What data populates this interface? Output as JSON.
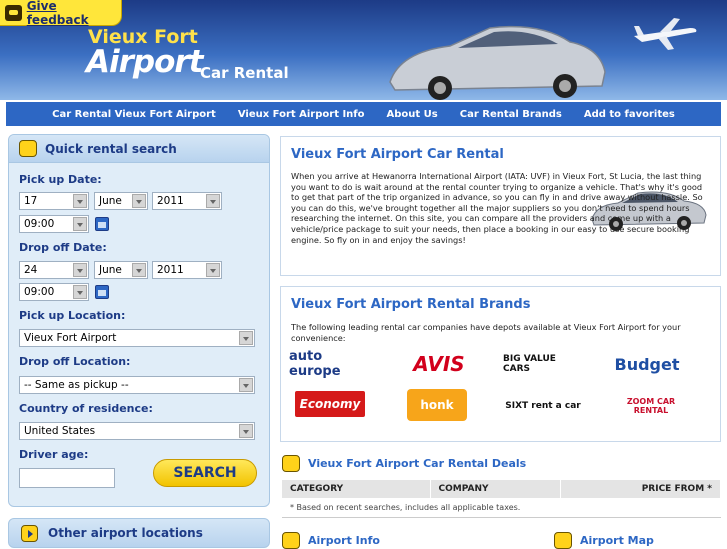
{
  "header": {
    "feedback_label": "Give feedback",
    "logo_line1": "Vieux Fort",
    "logo_line2": "Airport",
    "logo_line3": "Car Rental"
  },
  "nav": [
    "Car Rental Vieux Fort Airport",
    "Vieux Fort Airport Info",
    "About Us",
    "Car Rental Brands",
    "Add to favorites"
  ],
  "search": {
    "title": "Quick rental search",
    "pickup_date_label": "Pick up Date:",
    "pickup_day": "17",
    "pickup_month": "June",
    "pickup_year": "2011",
    "pickup_time": "09:00",
    "dropoff_date_label": "Drop off Date:",
    "dropoff_day": "24",
    "dropoff_month": "June",
    "dropoff_year": "2011",
    "dropoff_time": "09:00",
    "pickup_location_label": "Pick up Location:",
    "pickup_location": "Vieux Fort Airport",
    "dropoff_location_label": "Drop off Location:",
    "dropoff_location": "-- Same as pickup --",
    "country_label": "Country of residence:",
    "country": "United States",
    "age_label": "Driver age:",
    "age_value": "",
    "button": "SEARCH"
  },
  "other_locations": "Other airport locations",
  "intro": {
    "title": "Vieux Fort Airport Car Rental",
    "text": "When you arrive at Hewanorra International Airport (IATA: UVF) in Vieux Fort, St Lucia, the last thing you want to do is wait around at the rental counter trying to organize a vehicle. That's why it's good to get that part of the trip organized in advance, so you can fly in and drive away without hassle. So you can do this, we've brought together all the major suppliers so you don't need to spend hours researching the internet. On this site, you can compare all the providers and come up with a vehicle/price package to suit your needs, then place a booking in our easy to use secure booking engine. So fly on in and enjoy the savings!"
  },
  "brands": {
    "title": "Vieux Fort Airport Rental Brands",
    "intro": "The following leading rental car companies have depots available at Vieux Fort Airport for your convenience:",
    "items": [
      "auto europe",
      "AVIS",
      "BIG VALUE CARS",
      "Budget",
      "Economy",
      "honk",
      "SIXT rent a car",
      "ZOOM CAR RENTAL"
    ]
  },
  "deals": {
    "title": "Vieux Fort Airport Car Rental Deals",
    "columns": [
      "CATEGORY",
      "COMPANY",
      "PRICE FROM *"
    ],
    "note": "* Based on recent searches, includes all applicable taxes."
  },
  "bottom": {
    "info": "Airport Info",
    "map": "Airport Map"
  },
  "colors": {
    "accent": "#2d67c4",
    "brand_yellow": "#ffd21a",
    "header_dark": "#1d3b86"
  }
}
